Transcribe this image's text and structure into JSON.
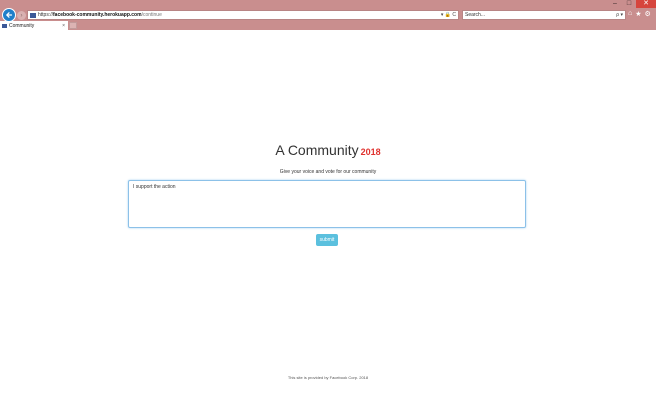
{
  "browser": {
    "window_controls": {
      "minimize": "–",
      "maximize": "□",
      "close": "✕"
    },
    "address": {
      "scheme": "https://",
      "host": "facebook-community.herokuapp.com",
      "path": "/continue",
      "controls": "▾ 🔒 C"
    },
    "search": {
      "placeholder": "Search...",
      "icon": "ρ ▾"
    },
    "toolbar": {
      "home": "⌂",
      "favorites": "★",
      "settings": "⚙"
    },
    "tab": {
      "label": "Community",
      "close": "×"
    }
  },
  "page": {
    "title": "A Community",
    "year": "2018",
    "subtitle": "Give your voice and vote for our community",
    "textarea_value": "I support the action",
    "submit_label": "submit",
    "footer": "This site is provided by Facebook Corp. 2018"
  },
  "colors": {
    "chrome": "#c98e8e",
    "accent_year": "#e0322e",
    "button": "#5bc0de",
    "textarea_border": "#8cc1e8"
  }
}
